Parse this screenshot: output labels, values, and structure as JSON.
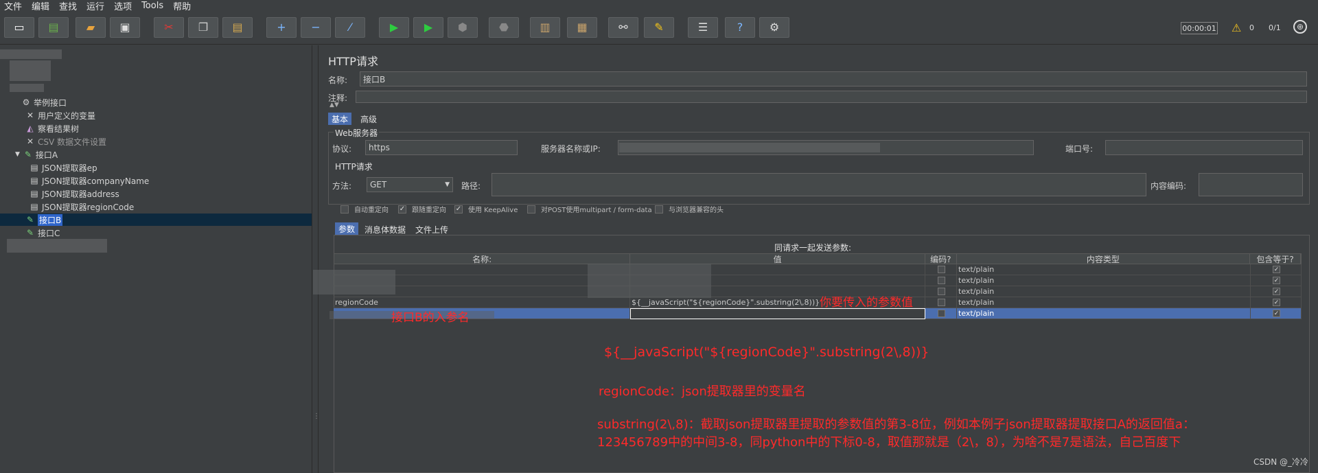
{
  "menu": [
    "文件",
    "编辑",
    "查找",
    "运行",
    "选项",
    "Tools",
    "帮助"
  ],
  "toolbar": {
    "icons": [
      "new-icon",
      "templates-icon",
      "open-icon",
      "save-icon",
      "cut-icon",
      "copy-icon",
      "paste-icon",
      "expand-icon",
      "collapse-icon",
      "toggle-icon",
      "start-icon",
      "start-no-pause-icon",
      "stop-icon",
      "shutdown-icon",
      "clear-icon",
      "clear-all-icon",
      "search-icon",
      "reset-search-icon",
      "function-helper-icon",
      "help-icon",
      "remote-icon"
    ],
    "timer": "00:00:01",
    "warnings": "0",
    "threads": "0/1"
  },
  "tree": {
    "items": [
      {
        "label": "举例接口",
        "icon": "testplan-icon"
      },
      {
        "label": "用户定义的变量",
        "icon": "config-icon"
      },
      {
        "label": "察看结果树",
        "icon": "listener-icon"
      },
      {
        "label": "CSV 数据文件设置",
        "icon": "config-icon"
      },
      {
        "label": "接口A",
        "icon": "sampler-icon",
        "expander": "▼"
      },
      {
        "label": "JSON提取器ep",
        "icon": "extractor-icon"
      },
      {
        "label": "JSON提取器companyName",
        "icon": "extractor-icon"
      },
      {
        "label": "JSON提取器address",
        "icon": "extractor-icon"
      },
      {
        "label": "JSON提取器regionCode",
        "icon": "extractor-icon"
      },
      {
        "label": "接口B",
        "icon": "sampler-icon"
      },
      {
        "label": "接口C",
        "icon": "sampler-icon"
      }
    ]
  },
  "panel": {
    "title": "HTTP请求",
    "name_label": "名称:",
    "name_value": "接口B",
    "comment_label": "注释:",
    "tabs": [
      "基本",
      "高级"
    ],
    "web_server_title": "Web服务器",
    "protocol_label": "协议:",
    "protocol_value": "https",
    "server_label": "服务器名称或IP:",
    "port_label": "端口号:",
    "http_request_title": "HTTP请求",
    "method_label": "方法:",
    "method_value": "GET",
    "path_label": "路径:",
    "encoding_label": "内容编码:",
    "checkboxes": [
      {
        "label": "自动重定向",
        "checked": false
      },
      {
        "label": "跟随重定向",
        "checked": true
      },
      {
        "label": "使用 KeepAlive",
        "checked": true
      },
      {
        "label": "对POST使用multipart / form-data",
        "checked": false
      },
      {
        "label": "与浏览器兼容的头",
        "checked": false
      }
    ],
    "subtabs": [
      "参数",
      "消息体数据",
      "文件上传"
    ],
    "send_params_title": "同请求一起发送参数:",
    "columns": [
      "名称:",
      "值",
      "编码?",
      "内容类型",
      "包含等于?"
    ],
    "rows": [
      {
        "name": "",
        "value": "",
        "encode": false,
        "type": "text/plain",
        "include": true
      },
      {
        "name": "",
        "value": "",
        "encode": false,
        "type": "text/plain",
        "include": true
      },
      {
        "name": "",
        "value": "",
        "encode": false,
        "type": "text/plain",
        "include": true
      },
      {
        "name": "regionCode",
        "value": "${__javaScript(\"${regionCode}\".substring(2\\,8))}",
        "encode": false,
        "type": "text/plain",
        "include": true
      },
      {
        "name": "",
        "value": "",
        "encode": false,
        "type": "text/plain",
        "include": true
      }
    ]
  },
  "annotations": {
    "param_name_note": "接口B的入参名",
    "param_value_note": "你要传入的参数值",
    "expr": "${__javaScript(\"${regionCode}\".substring(2\\,8))}",
    "line1": "regionCode：json提取器里的变量名",
    "line2": "substring(2\\,8)：截取json提取器里提取的参数值的第3-8位，例如本例子json提取器提取接口A的返回值a：",
    "line3": "123456789中的中间3-8，同python中的下标0-8，取值那就是（2\\，8），为啥不是7是语法，自己百度下"
  },
  "watermark": "CSDN @_冷冷",
  "colors": {
    "bg": "#3c3f41",
    "selection": "#2f65ca",
    "annotation": "#ff2a2a"
  }
}
